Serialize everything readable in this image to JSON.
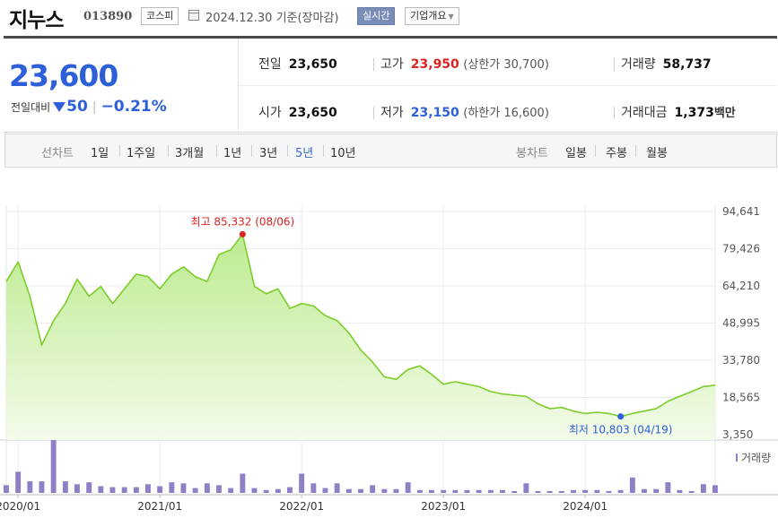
{
  "header": {
    "stock_name": "지누스",
    "stock_code": "013890",
    "market": "코스피",
    "date_basis": "2024.12.30 기준(장마감)",
    "realtime_button": "실시간",
    "company_overview_button": "기업개요"
  },
  "price": {
    "current": "23,600",
    "change_label": "전일대비",
    "change_value": "50",
    "change_rate": "−0.21%"
  },
  "stats": {
    "prev_close_label": "전일",
    "prev_close": "23,650",
    "high_label": "고가",
    "high": "23,950",
    "upper_limit": "(상한가 30,700)",
    "volume_label": "거래량",
    "volume": "58,737",
    "open_label": "시가",
    "open": "23,650",
    "low_label": "저가",
    "low": "23,150",
    "lower_limit": "(하한가 16,600)",
    "amount_label": "거래대금",
    "amount": "1,373",
    "amount_unit": "백만"
  },
  "periods": {
    "line_label": "선차트",
    "line_items": [
      "1일",
      "1주일",
      "3개월",
      "1년",
      "3년",
      "5년",
      "10년"
    ],
    "active_index": 5,
    "candle_label": "봉차트",
    "candle_items": [
      "일봉",
      "주봉",
      "월봉"
    ]
  },
  "colors": {
    "accent_blue": "#2d5fd8",
    "up_red": "#dd2222",
    "line_green": "#7ccd2a",
    "volume_purple": "#8f7fc6"
  },
  "chart_data": {
    "type": "area",
    "title": "",
    "xlabel": "",
    "ylabel": "",
    "x_start": "2019-12",
    "x_end": "2024-12",
    "x_ticks": [
      "2020/01",
      "2021/01",
      "2022/01",
      "2023/01",
      "2024/01"
    ],
    "y_ticks": [
      94641,
      79426,
      64210,
      48995,
      33780,
      18565,
      3350
    ],
    "ylim": [
      3350,
      94641
    ],
    "grid": true,
    "series": [
      {
        "name": "",
        "x": [
          "2019-12",
          "2020-01",
          "2020-02",
          "2020-03",
          "2020-04",
          "2020-05",
          "2020-06",
          "2020-07",
          "2020-08",
          "2020-09",
          "2020-10",
          "2020-11",
          "2020-12",
          "2021-01",
          "2021-02",
          "2021-03",
          "2021-04",
          "2021-05",
          "2021-06",
          "2021-07",
          "2021-08",
          "2021-09",
          "2021-10",
          "2021-11",
          "2021-12",
          "2022-01",
          "2022-02",
          "2022-03",
          "2022-04",
          "2022-05",
          "2022-06",
          "2022-07",
          "2022-08",
          "2022-09",
          "2022-10",
          "2022-11",
          "2022-12",
          "2023-01",
          "2023-02",
          "2023-03",
          "2023-04",
          "2023-05",
          "2023-06",
          "2023-07",
          "2023-08",
          "2023-09",
          "2023-10",
          "2023-11",
          "2023-12",
          "2024-01",
          "2024-02",
          "2024-03",
          "2024-04",
          "2024-05",
          "2024-06",
          "2024-07",
          "2024-08",
          "2024-09",
          "2024-10",
          "2024-11",
          "2024-12"
        ],
        "values": [
          66000,
          74000,
          60000,
          40000,
          50000,
          57000,
          67000,
          60000,
          64000,
          57000,
          63000,
          69000,
          68000,
          63000,
          69000,
          72000,
          68000,
          66000,
          77000,
          79000,
          85332,
          64000,
          61000,
          63000,
          55000,
          57000,
          56000,
          52000,
          50000,
          45000,
          38000,
          33000,
          27000,
          26000,
          30000,
          31500,
          28000,
          24000,
          25000,
          24000,
          23000,
          21000,
          20000,
          19500,
          19000,
          16000,
          14000,
          14500,
          13000,
          12000,
          12500,
          12000,
          10803,
          12000,
          13000,
          14000,
          17000,
          19000,
          21000,
          23000,
          23600
        ]
      }
    ],
    "volume": {
      "name": "거래량",
      "values": [
        8,
        22,
        12,
        12,
        55,
        12,
        9,
        11,
        7,
        6,
        6,
        6,
        9,
        7,
        11,
        10,
        5,
        10,
        8,
        5,
        20,
        5,
        3,
        4,
        6,
        20,
        10,
        5,
        10,
        4,
        4,
        8,
        4,
        4,
        11,
        3,
        3,
        3,
        3,
        3,
        3,
        3,
        3,
        2,
        10,
        2,
        2,
        2,
        3,
        3,
        3,
        2,
        3,
        16,
        4,
        4,
        11,
        3,
        2,
        9,
        8
      ]
    },
    "annotations": [
      {
        "label": "최고 85,332 (08/06)",
        "x": "2021-08",
        "value": 85332
      },
      {
        "label": "최저 10,803 (04/19)",
        "x": "2024-04",
        "value": 10803
      }
    ],
    "volume_legend": "거래량"
  }
}
